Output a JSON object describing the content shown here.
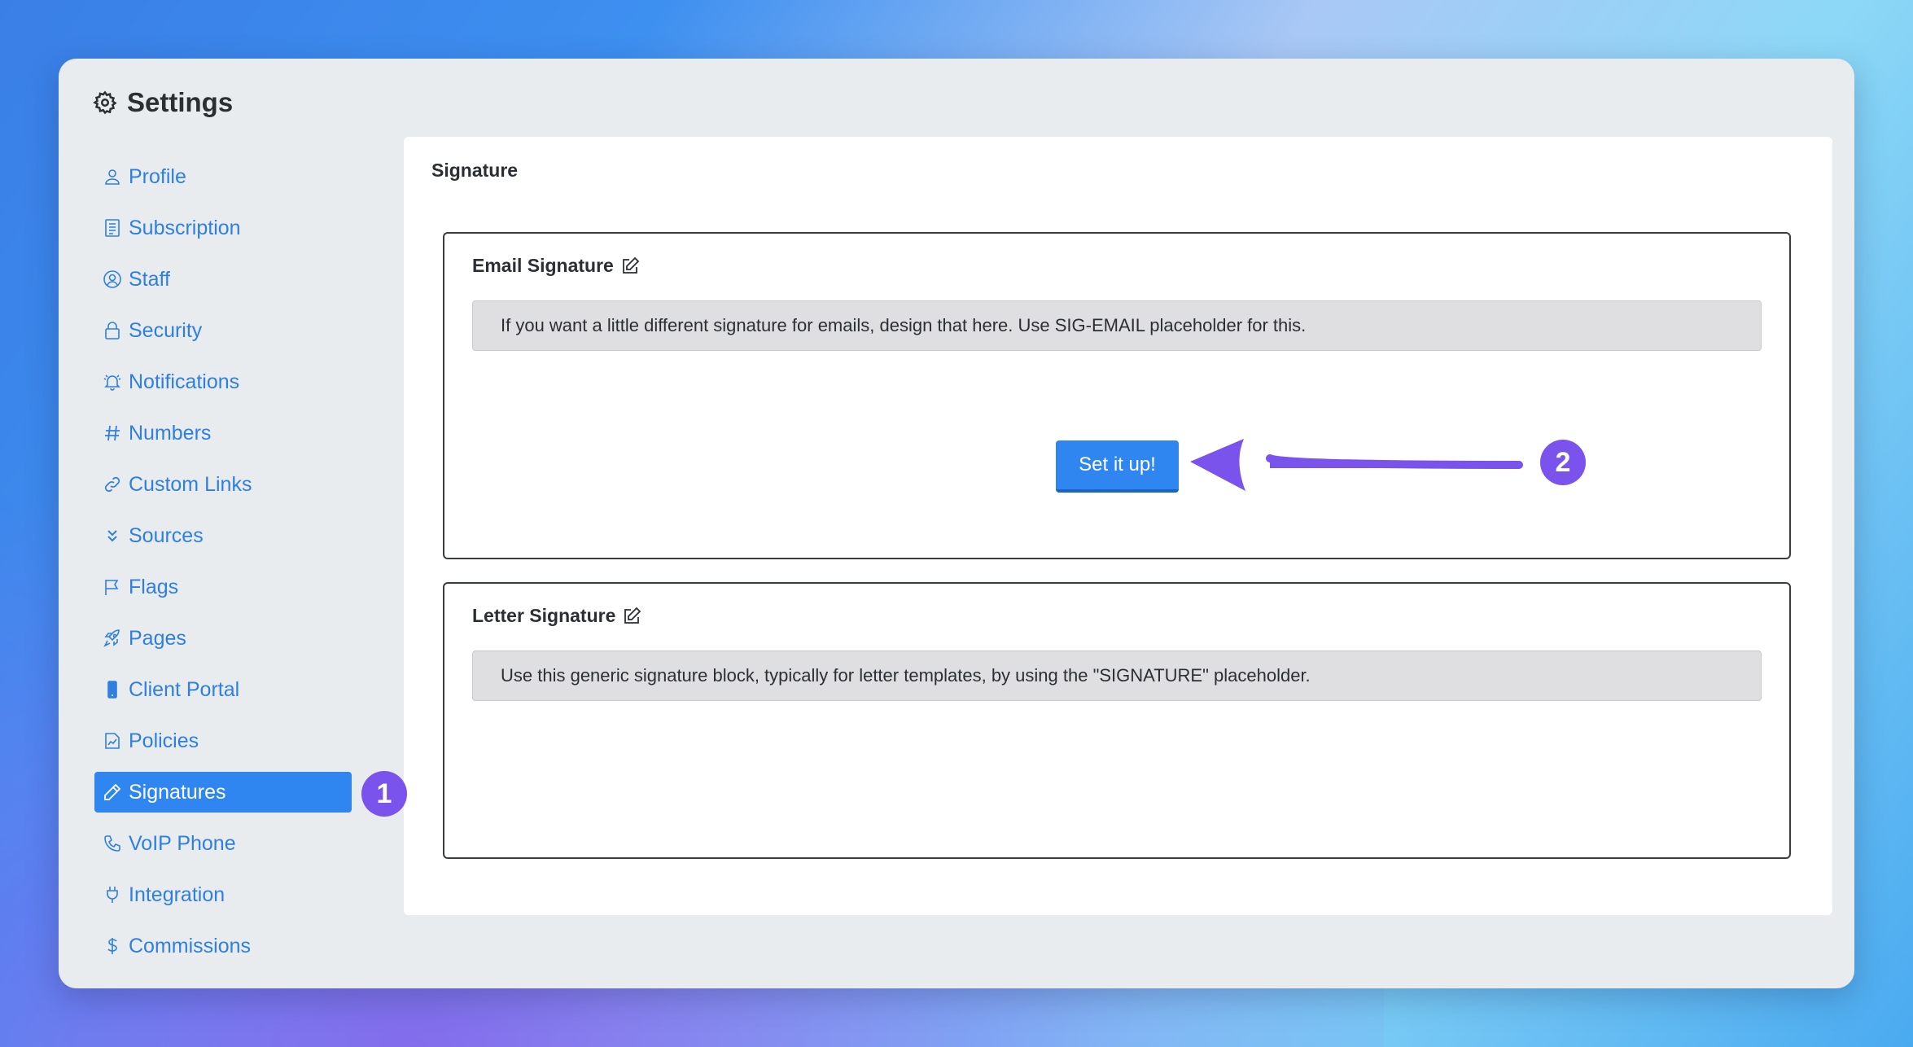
{
  "window": {
    "title": "Settings",
    "title_icon": "gear-icon"
  },
  "sidebar": {
    "items": [
      {
        "label": "Profile",
        "icon": "user-icon"
      },
      {
        "label": "Subscription",
        "icon": "receipt-icon"
      },
      {
        "label": "Staff",
        "icon": "user-circle-icon"
      },
      {
        "label": "Security",
        "icon": "lock-icon"
      },
      {
        "label": "Notifications",
        "icon": "bell-icon"
      },
      {
        "label": "Numbers",
        "icon": "hash-icon"
      },
      {
        "label": "Custom Links",
        "icon": "link-icon"
      },
      {
        "label": "Sources",
        "icon": "chevrons-down-icon"
      },
      {
        "label": "Flags",
        "icon": "flag-icon"
      },
      {
        "label": "Pages",
        "icon": "rocket-icon"
      },
      {
        "label": "Client Portal",
        "icon": "phone-device-icon"
      },
      {
        "label": "Policies",
        "icon": "document-chart-icon"
      },
      {
        "label": "Signatures",
        "icon": "pencil-icon",
        "active": true
      },
      {
        "label": "VoIP Phone",
        "icon": "telephone-icon"
      },
      {
        "label": "Integration",
        "icon": "plug-icon"
      },
      {
        "label": "Commissions",
        "icon": "dollar-icon"
      }
    ]
  },
  "panel": {
    "title": "Signature",
    "email_card": {
      "title": "Email Signature",
      "edit_icon": "edit-icon",
      "info": "If you want a little different signature for emails, design that here. Use SIG-EMAIL placeholder for this.",
      "button_label": "Set it up!"
    },
    "letter_card": {
      "title": "Letter Signature",
      "edit_icon": "edit-icon",
      "info": "Use this generic signature block, typically for letter templates, by using the \"SIGNATURE\" placeholder."
    }
  },
  "annotations": {
    "step1": "1",
    "step2": "2"
  },
  "colors": {
    "accent": "#2f86f0",
    "link": "#2f7fe0",
    "annotation": "#7a52ec"
  }
}
